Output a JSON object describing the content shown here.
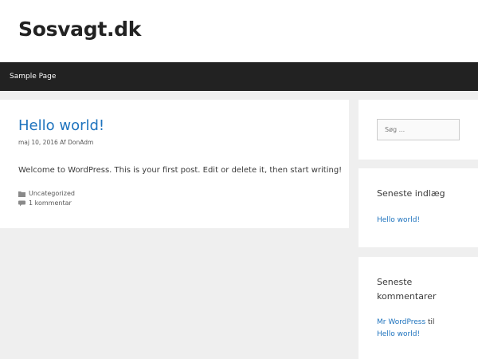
{
  "header": {
    "site_title": "Sosvagt.dk"
  },
  "nav": {
    "items": [
      {
        "label": "Sample Page"
      }
    ]
  },
  "post": {
    "title": "Hello world!",
    "date": "maj 10, 2016",
    "by": "Af",
    "author": "DonAdm",
    "body": "Welcome to WordPress. This is your first post. Edit or delete it, then start writing!",
    "category": "Uncategorized",
    "comments": "1 kommentar",
    "category_icon": "folder-icon",
    "comment_icon": "comment-icon"
  },
  "sidebar": {
    "search_placeholder": "Søg ...",
    "recent_posts": {
      "title": "Seneste indlæg",
      "items": [
        "Hello world!"
      ]
    },
    "recent_comments": {
      "title": "Seneste kommentarer",
      "items": [
        {
          "author": "Mr WordPress",
          "on": "til",
          "post": "Hello world!"
        }
      ]
    }
  },
  "colors": {
    "link": "#1e73be",
    "nav_bg": "#222222",
    "page_bg": "#efefef"
  }
}
